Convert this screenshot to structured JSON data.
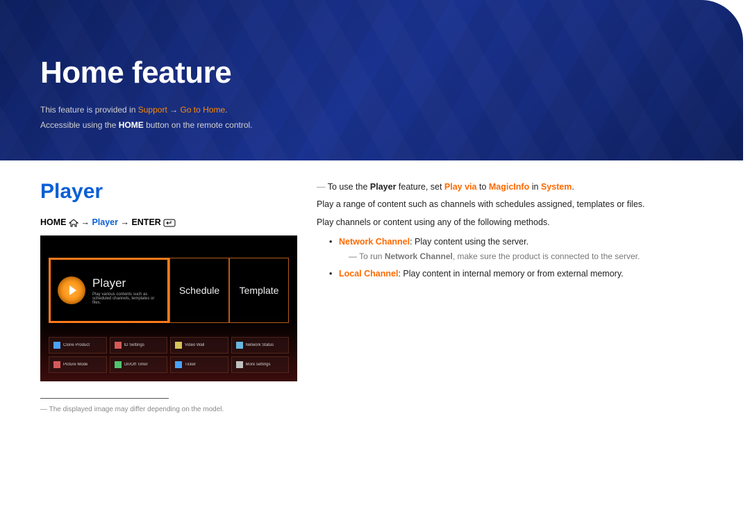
{
  "banner": {
    "title": "Home feature",
    "line1_pre": "This feature is provided in ",
    "line1_support": "Support",
    "line1_arrow": " → ",
    "line1_gotohome": "Go to Home",
    "line1_end": ".",
    "line2_pre": "Accessible using the ",
    "line2_home": "HOME",
    "line2_post": " button on the remote control."
  },
  "left": {
    "section_title": "Player",
    "breadcrumb": {
      "home": "HOME",
      "arrow": " → ",
      "player": "Player",
      "enter": "ENTER"
    },
    "screenshot": {
      "card1": {
        "title": "Player",
        "sub": "Play various contents such as scheduled channels, templates or files."
      },
      "card2": {
        "title": "Schedule"
      },
      "card3": {
        "title": "Template"
      },
      "grid": [
        [
          "Clone Product",
          "ID Settings",
          "Video Wall",
          "Network Status"
        ],
        [
          "Picture Mode",
          "On/Off Timer",
          "Ticker",
          "More settings"
        ]
      ],
      "grid_colors": [
        [
          "#4aa3ff",
          "#d65a5a",
          "#d6c45a",
          "#67b8e0"
        ],
        [
          "#d65a5a",
          "#51c46e",
          "#4aa3ff",
          "#c0c0c0"
        ]
      ]
    },
    "footnote": "The displayed image may differ depending on the model."
  },
  "right": {
    "note1_pre": "To use the ",
    "note1_player": "Player",
    "note1_mid1": " feature, set ",
    "note1_playvia": "Play via",
    "note1_mid2": " to ",
    "note1_magicinfo": "MagicInfo",
    "note1_mid3": " in ",
    "note1_system": "System",
    "note1_end": ".",
    "para1": "Play a range of content such as channels with schedules assigned, templates or files.",
    "para2": "Play channels or content using any of the following methods.",
    "bullet1_label": "Network Channel",
    "bullet1_text": ": Play content using the server.",
    "bullet1_sub_pre": "To run ",
    "bullet1_sub_bold": "Network Channel",
    "bullet1_sub_post": ", make sure the product is connected to the server.",
    "bullet2_label": "Local Channel",
    "bullet2_text": ": Play content in internal memory or from external memory."
  }
}
